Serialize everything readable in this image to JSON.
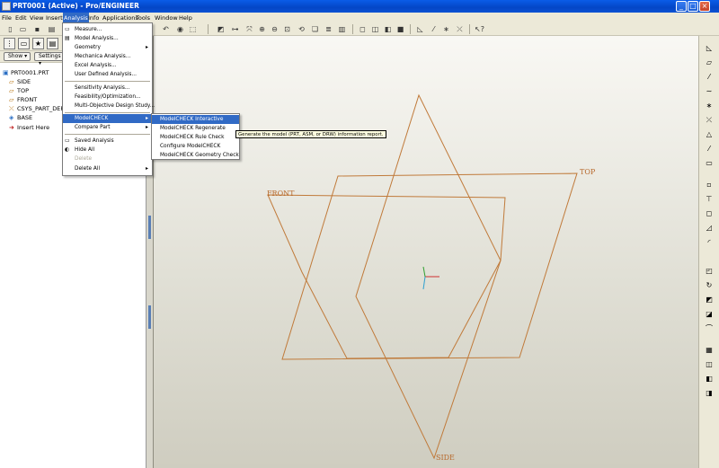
{
  "window": {
    "title": "PRT0001 (Active) - Pro/ENGINEER",
    "minimize_icon": "minimize-icon",
    "maximize_icon": "maximize-icon",
    "close_icon": "close-icon"
  },
  "menubar": {
    "items": [
      "File",
      "Edit",
      "View",
      "Insert",
      "Analysis",
      "Info",
      "Applications",
      "Tools",
      "Window",
      "Help"
    ],
    "active": "Analysis"
  },
  "model_tree": {
    "show_label": "Show",
    "settings_label": "Settings",
    "root": "PRT0001.PRT",
    "items": [
      "SIDE",
      "TOP",
      "FRONT",
      "CSYS_PART_DEF",
      "BASE",
      "Insert Here"
    ]
  },
  "analysis_menu": {
    "items": [
      {
        "label": "Measure...",
        "submenu": false
      },
      {
        "label": "Model Analysis...",
        "submenu": false
      },
      {
        "label": "Geometry",
        "submenu": true
      },
      {
        "label": "Mechanica Analysis...",
        "submenu": false
      },
      {
        "label": "Excel Analysis...",
        "submenu": false
      },
      {
        "label": "User Defined Analysis...",
        "submenu": false
      },
      {
        "label": "Sensitivity Analysis...",
        "submenu": false
      },
      {
        "label": "Feasibility/Optimization...",
        "submenu": false
      },
      {
        "label": "Multi-Objective Design Study...",
        "submenu": false
      },
      {
        "label": "ModelCHECK",
        "submenu": true,
        "highlighted": true
      },
      {
        "label": "Compare Part",
        "submenu": true
      },
      {
        "label": "Saved Analysis",
        "submenu": false
      },
      {
        "label": "Hide All",
        "submenu": false
      },
      {
        "label": "Delete",
        "submenu": false,
        "disabled": true
      },
      {
        "label": "Delete All",
        "submenu": true
      }
    ]
  },
  "modelcheck_submenu": {
    "items": [
      {
        "label": "ModelCHECK Interactive",
        "highlighted": true
      },
      {
        "label": "ModelCHECK Regenerate"
      },
      {
        "label": "ModelCHECK Rule Check"
      },
      {
        "label": "Configure ModelCHECK"
      },
      {
        "label": "ModelCHECK Geometry Check"
      }
    ]
  },
  "tooltip": "Generate the model (PRT, ASM, or DRW) information report.",
  "datum_planes": {
    "front": "FRONT",
    "top": "TOP",
    "side": "SIDE",
    "color": "#c07a3a"
  }
}
